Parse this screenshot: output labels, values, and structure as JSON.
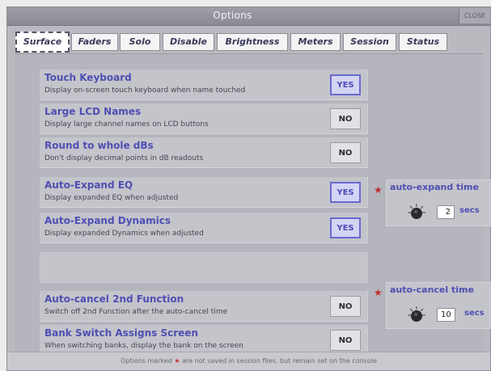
{
  "window": {
    "title": "Options",
    "close_label": "CLOSE"
  },
  "tabs": [
    {
      "label": "Surface",
      "active": true
    },
    {
      "label": "Faders"
    },
    {
      "label": "Solo"
    },
    {
      "label": "Disable"
    },
    {
      "label": "Brightness"
    },
    {
      "label": "Meters"
    },
    {
      "label": "Session"
    },
    {
      "label": "Status"
    }
  ],
  "options": [
    {
      "label": "Touch Keyboard",
      "description": "Display on-screen touch keyboard when name touched",
      "value": "YES"
    },
    {
      "label": "Large LCD Names",
      "description": "Display large channel names on LCD buttons",
      "value": "NO"
    },
    {
      "label": "Round to whole dBs",
      "description": "Don't display decimal points in dB readouts",
      "value": "NO"
    },
    {
      "label": "Auto-Expand EQ",
      "description": "Display expanded EQ when adjusted",
      "value": "YES"
    },
    {
      "label": "Auto-Expand Dynamics",
      "description": "Display expanded Dynamics when adjusted",
      "value": "YES"
    },
    {
      "label": "Auto-cancel 2nd Function",
      "description": "Switch off 2nd Function after the auto-cancel time",
      "value": "NO"
    },
    {
      "label": "Bank Switch Assigns Screen",
      "description": "When switching banks, display the bank on the screen",
      "value": "NO"
    }
  ],
  "auto_expand": {
    "label": "auto-expand time",
    "value": "2",
    "unit": "secs",
    "star": "★"
  },
  "auto_cancel": {
    "label": "auto-cancel time",
    "value": "10",
    "unit": "secs",
    "star": "★"
  },
  "footer": {
    "before": "Options marked",
    "star": "★",
    "after": "are not saved in session files, but remain set on the console"
  },
  "colors": {
    "accent": "#4f4fb4",
    "star": "#c0302e",
    "yes_fill": "#d4d4f4",
    "panel": "#b5b5bd"
  },
  "icons": {
    "knob": "rotary-knob-icon",
    "star": "star-icon"
  }
}
